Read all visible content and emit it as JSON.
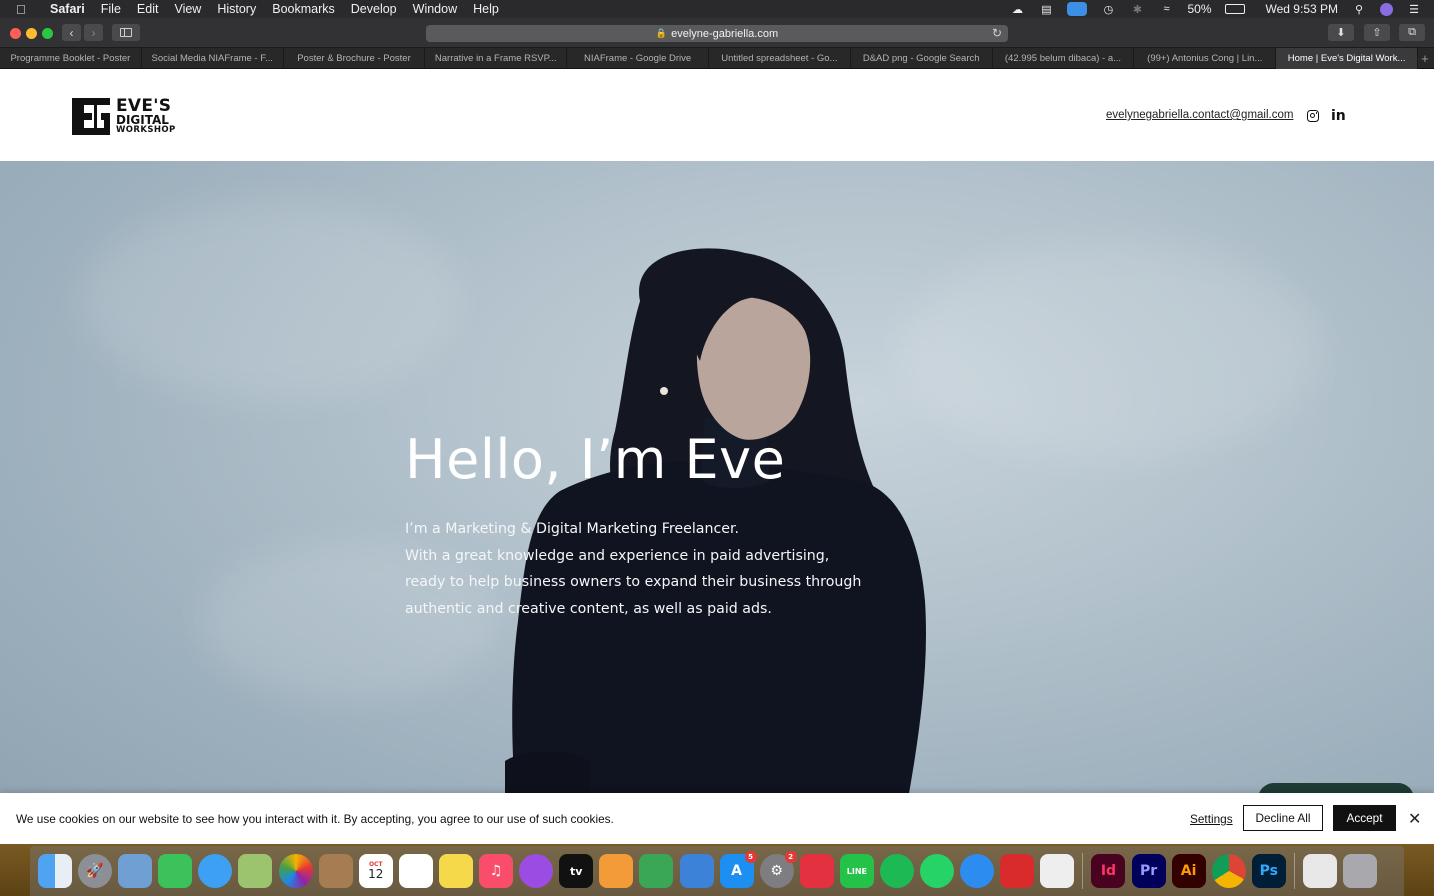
{
  "menubar": {
    "app_name": "Safari",
    "menus": [
      "File",
      "Edit",
      "View",
      "History",
      "Bookmarks",
      "Develop",
      "Window",
      "Help"
    ],
    "battery": "50%",
    "clock": "Wed 9:53 PM"
  },
  "browser": {
    "url": "evelyne-gabriella.com",
    "tabs": [
      {
        "title": "Programme Booklet - Poster"
      },
      {
        "title": "Social Media NIAFrame - F..."
      },
      {
        "title": "Poster & Brochure - Poster"
      },
      {
        "title": "Narrative in a Frame RSVP..."
      },
      {
        "title": "NIAFrame - Google Drive"
      },
      {
        "title": "Untitled spreadsheet - Go..."
      },
      {
        "title": "D&AD png - Google Search"
      },
      {
        "title": "(42.995 belum dibaca) - a..."
      },
      {
        "title": "(99+) Antonius Cong | Lin..."
      },
      {
        "title": "Home | Eve's Digital Work..."
      }
    ]
  },
  "site": {
    "logo": {
      "line1": "EVE'S",
      "line2": "DIGITAL",
      "line3": "WORKSHOP"
    },
    "email": "evelynegabriella.contact@gmail.com",
    "linkedin_label": "in",
    "hero": {
      "title": "Hello, I’m Eve",
      "lines": [
        "I’m a Marketing & Digital Marketing Freelancer.",
        "With a great knowledge and experience in paid advertising,",
        "ready to help business owners to expand their business through",
        "authentic and creative content, as well as paid ads."
      ]
    }
  },
  "cookie": {
    "text": "We use cookies on our website to see how you interact with it. By accepting, you agree to our use of such cookies.",
    "settings": "Settings",
    "decline": "Decline All",
    "accept": "Accept"
  },
  "dock": {
    "calendar_month": "OCT",
    "calendar_day": "12",
    "appstore_badge": "5",
    "settings_badge": "2",
    "indesign": "Id",
    "premiere": "Pr",
    "illustrator": "Ai",
    "photoshop": "Ps",
    "tv_label": "tv"
  },
  "colors": {
    "accept_bg": "#111111",
    "hero_sky": "#b3c2cc",
    "chat_tab": "#1e3b34"
  }
}
